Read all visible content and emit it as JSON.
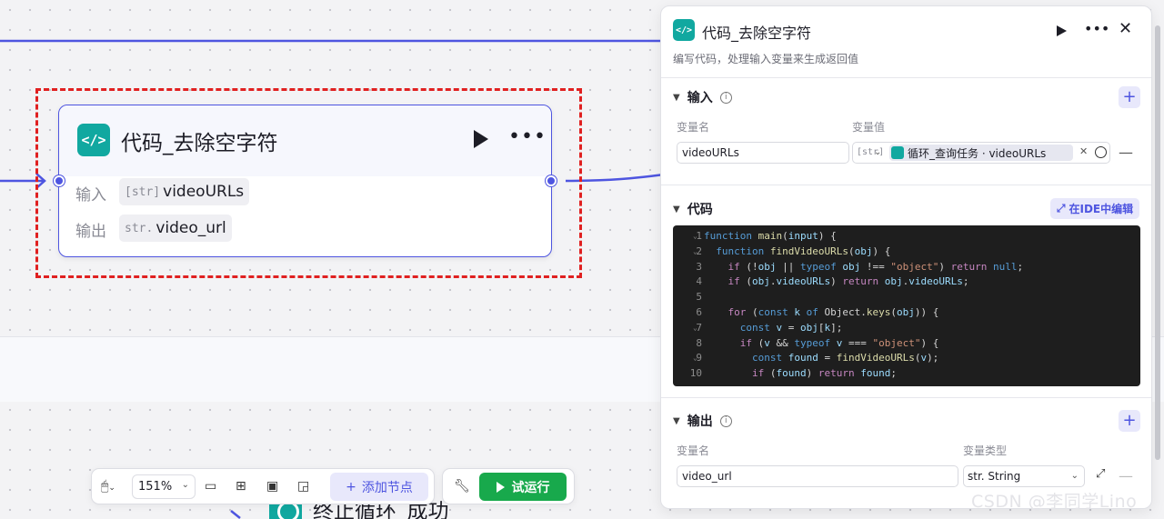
{
  "canvas_node": {
    "icon": "</>",
    "title": "代码_去除空字符",
    "input_label": "输入",
    "input_type": "[str]",
    "input_var": "videoURLs",
    "output_label": "输出",
    "output_type": "str.",
    "output_var": "video_url"
  },
  "next_node": {
    "title": "终止循环_成功"
  },
  "toolbar": {
    "zoom": "151%",
    "add_node": "添加节点",
    "trial_run": "试运行"
  },
  "panel": {
    "icon": "</>",
    "title": "代码_去除空字符",
    "description": "编写代码，处理输入变量来生成返回值",
    "input": {
      "heading": "输入",
      "col_name": "变量名",
      "col_value": "变量值",
      "var_name": "videoURLs",
      "var_type": "[str]",
      "var_ref": "循环_查询任务 · videoURLs"
    },
    "code": {
      "heading": "代码",
      "ide_button": "在IDE中编辑",
      "line_numbers": "1\n2\n3\n4\n5\n6\n7\n8\n9\n10"
    },
    "output": {
      "heading": "输出",
      "col_name": "变量名",
      "col_type": "变量类型",
      "var_name": "video_url",
      "var_type": "str. String"
    }
  },
  "watermark": "CSDN @李同学Lino",
  "colors": {
    "accent": "#4e55e0",
    "teal": "#11a8a0",
    "run_green": "#18a94c",
    "selection_red": "#e02020"
  }
}
